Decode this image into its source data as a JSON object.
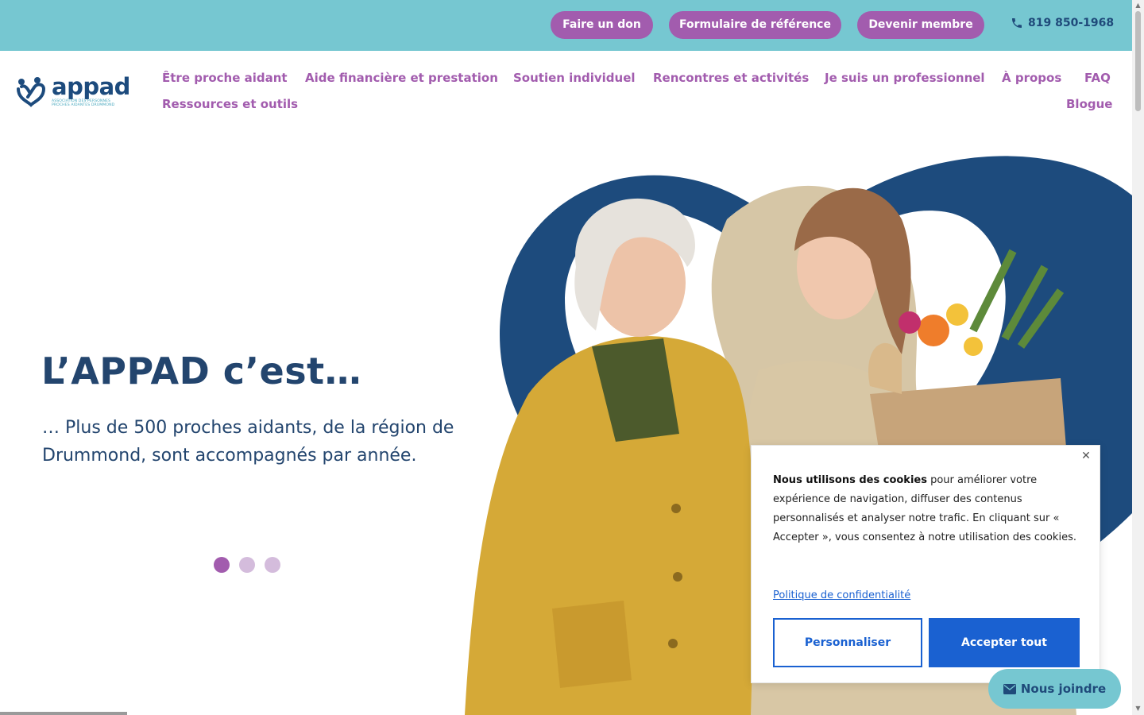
{
  "topbar": {
    "buttons": [
      {
        "label": "Faire un don"
      },
      {
        "label": "Formulaire de référence"
      },
      {
        "label": "Devenir membre"
      }
    ],
    "phone": "819 850-1968"
  },
  "logo": {
    "word": "appad",
    "subtitle": "ASSOCIATION DES PERSONNES PROCHES AIDANTES DRUMMOND"
  },
  "nav": {
    "items": [
      {
        "label": "Être proche aidant"
      },
      {
        "label": "Aide financière et prestation"
      },
      {
        "label": "Soutien individuel"
      },
      {
        "label": "Rencontres et activités"
      },
      {
        "label": "Je suis un professionnel"
      },
      {
        "label": "À propos"
      },
      {
        "label": "FAQ"
      },
      {
        "label": "Ressources et outils"
      },
      {
        "label": "Blogue"
      }
    ]
  },
  "hero": {
    "title": "L’APPAD c’est…",
    "text": "… Plus de 500 proches aidants, de la région de Drummond, sont accompagnés par année.",
    "slides": 3,
    "active_slide": 1
  },
  "cookie": {
    "bold": "Nous utilisons des cookies",
    "text": " pour améliorer votre expérience de navigation, diffuser des contenus personnalisés et analyser notre trafic. En cliquant sur « Accepter », vous consentez à notre utilisation des cookies.",
    "policy_link": "Politique de confidentialité",
    "customize": "Personnaliser",
    "accept": "Accepter tout",
    "close_icon": "close-icon"
  },
  "contact": {
    "label": "Nous joindre",
    "icon": "envelope-icon"
  },
  "colors": {
    "topbar": "#76c7d1",
    "accent_purple": "#a25cae",
    "navy": "#23456e",
    "cookie_blue": "#1a61d1"
  }
}
